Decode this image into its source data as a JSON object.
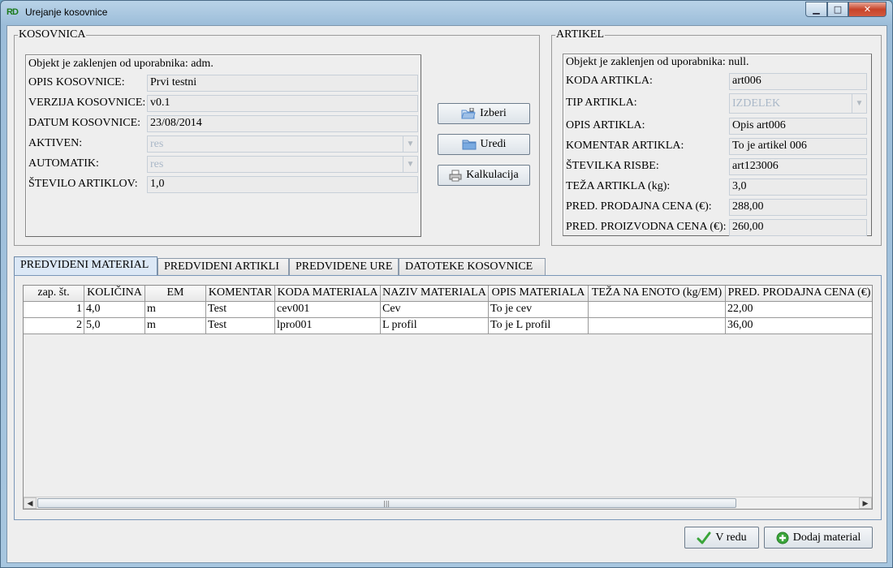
{
  "window": {
    "app_logo": "RD",
    "title": "Urejanje kosovnice",
    "min_glyph": "▁",
    "max_glyph": "□",
    "close_glyph": "✕"
  },
  "kosovnica": {
    "group_title": "KOSOVNICA",
    "lock_text": "Objekt je zaklenjen od uporabnika: adm.",
    "opis_label": "OPIS KOSOVNICE:",
    "opis_value": "Prvi testni",
    "verzija_label": "VERZIJA KOSOVNICE:",
    "verzija_value": "v0.1",
    "datum_label": "DATUM KOSOVNICE:",
    "datum_value": "23/08/2014",
    "aktiven_label": "AKTIVEN:",
    "aktiven_value": "res",
    "automatik_label": "AUTOMATIK:",
    "automatik_value": "res",
    "stevilo_label": "ŠTEVILO ARTIKLOV:",
    "stevilo_value": "1,0"
  },
  "actions": {
    "izberi": "Izberi",
    "uredi": "Uredi",
    "kalkulacija": "Kalkulacija"
  },
  "artikel": {
    "group_title": "ARTIKEL",
    "lock_text": "Objekt je zaklenjen od uporabnika: null.",
    "koda_label": "KODA ARTIKLA:",
    "koda_value": "art006",
    "tip_label": "TIP ARTIKLA:",
    "tip_value": "IZDELEK",
    "opis_label": "OPIS ARTIKLA:",
    "opis_value": "Opis art006",
    "komentar_label": "KOMENTAR ARTIKLA:",
    "komentar_value": "To je artikel 006",
    "risba_label": "ŠTEVILKA RISBE:",
    "risba_value": "art123006",
    "teza_label": "TEŽA ARTIKLA (kg):",
    "teza_value": "3,0",
    "prodajna_label": "PRED. PRODAJNA CENA (€):",
    "prodajna_value": "288,00",
    "proizvodna_label": "PRED. PROIZVODNA CENA (€):",
    "proizvodna_value": "260,00"
  },
  "tabs": [
    {
      "label": "PREDVIDENI MATERIAL",
      "active": true
    },
    {
      "label": "PREDVIDENI ARTIKLI",
      "active": false
    },
    {
      "label": "PREDVIDENE URE",
      "active": false
    },
    {
      "label": "DATOTEKE KOSOVNICE",
      "active": false
    }
  ],
  "table": {
    "columns": [
      "zap. št.",
      "KOLIČINA",
      "EM",
      "KOMENTAR",
      "KODA MATERIALA",
      "NAZIV MATERIALA",
      "OPIS MATERIALA",
      "TEŽA NA ENOTO (kg/EM)",
      "PRED. PRODAJNA CENA (€)"
    ],
    "rows": [
      [
        "1",
        "4,0",
        "m",
        "Test",
        "cev001",
        "Cev",
        "To je cev",
        "",
        "22,00"
      ],
      [
        "2",
        "5,0",
        "m",
        "Test",
        "lpro001",
        "L profil",
        "To je L profil",
        "",
        "36,00"
      ]
    ]
  },
  "footer": {
    "ok": "V redu",
    "add": "Dodaj material"
  },
  "colors": {
    "ok_icon": "#3aa53a",
    "add_icon": "#3aa53a",
    "folder_icon": "#5a8fd0"
  }
}
